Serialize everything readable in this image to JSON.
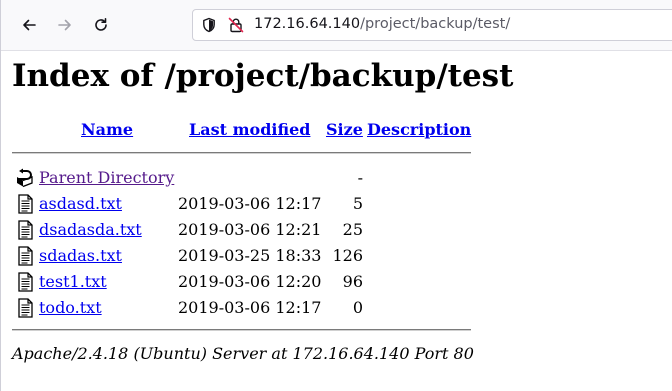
{
  "browser": {
    "url_host": "172.16.64.140",
    "url_path": "/project/backup/test/"
  },
  "page": {
    "title": "Index of /project/backup/test",
    "columns": {
      "name": "Name",
      "last_modified": "Last modified",
      "size": "Size",
      "description": "Description"
    },
    "parent": {
      "label": "Parent Directory",
      "size": "-",
      "icon": "back-folder-icon"
    },
    "files": [
      {
        "name": "asdasd.txt",
        "date": "2019-03-06 12:17",
        "size": "5",
        "icon": "text-file-icon"
      },
      {
        "name": "dsadasda.txt",
        "date": "2019-03-06 12:21",
        "size": "25",
        "icon": "text-file-icon"
      },
      {
        "name": "sdadas.txt",
        "date": "2019-03-25 18:33",
        "size": "126",
        "icon": "text-file-icon"
      },
      {
        "name": "test1.txt",
        "date": "2019-03-06 12:20",
        "size": "96",
        "icon": "text-file-icon"
      },
      {
        "name": "todo.txt",
        "date": "2019-03-06 12:17",
        "size": "0",
        "icon": "text-file-icon"
      }
    ],
    "footer": "Apache/2.4.18 (Ubuntu) Server at 172.16.64.140 Port 80"
  },
  "colors": {
    "link": "#0000ee",
    "visited_link": "#551a8b"
  }
}
